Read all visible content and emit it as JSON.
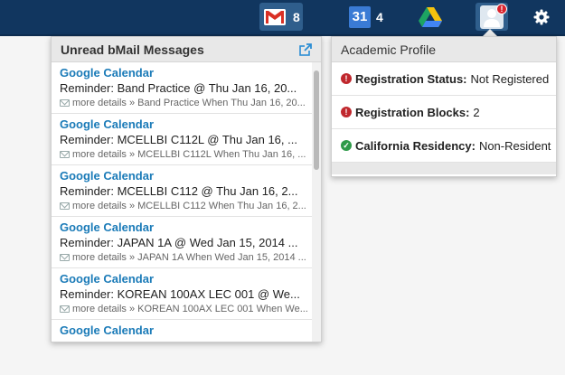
{
  "topbar": {
    "mail": {
      "icon": "gmail-icon",
      "count": "8"
    },
    "calendar": {
      "icon": "calendar-icon",
      "day": "31",
      "count": "4"
    },
    "drive": {
      "icon": "google-drive-icon"
    },
    "profile": {
      "icon": "user-icon",
      "alert": "!"
    },
    "settings": {
      "icon": "gear-icon"
    }
  },
  "bmail": {
    "title": "Unread bMail Messages",
    "external_icon": "external-link-icon",
    "messages": [
      {
        "sender": "Google Calendar",
        "subject": "Reminder: Band Practice @ Thu Jan 16, 20...",
        "details": "more details » Band Practice When Thu Jan 16, 20..."
      },
      {
        "sender": "Google Calendar",
        "subject": "Reminder: MCELLBI C112L @ Thu Jan 16, ...",
        "details": "more details » MCELLBI C112L When Thu Jan 16, ..."
      },
      {
        "sender": "Google Calendar",
        "subject": "Reminder: MCELLBI C112 @ Thu Jan 16, 2...",
        "details": "more details » MCELLBI C112 When Thu Jan 16, 2..."
      },
      {
        "sender": "Google Calendar",
        "subject": "Reminder: JAPAN 1A @ Wed Jan 15, 2014 ...",
        "details": "more details » JAPAN 1A When Wed Jan 15, 2014 ..."
      },
      {
        "sender": "Google Calendar",
        "subject": "Reminder: KOREAN 100AX LEC 001 @ We...",
        "details": "more details » KOREAN 100AX LEC 001 When We..."
      },
      {
        "sender": "Google Calendar",
        "subject": "",
        "details": ""
      }
    ]
  },
  "academic": {
    "title": "Academic Profile",
    "rows": [
      {
        "icon": "error-icon",
        "label": "Registration Status:",
        "value": "Not Registered"
      },
      {
        "icon": "error-icon",
        "label": "Registration Blocks:",
        "value": "2"
      },
      {
        "icon": "check-icon",
        "label": "California Residency:",
        "value": "Non-Resident"
      }
    ]
  },
  "colors": {
    "topbar": "#11365f",
    "link": "#1b7bb8",
    "error": "#c0272d",
    "ok": "#2e9a49"
  }
}
